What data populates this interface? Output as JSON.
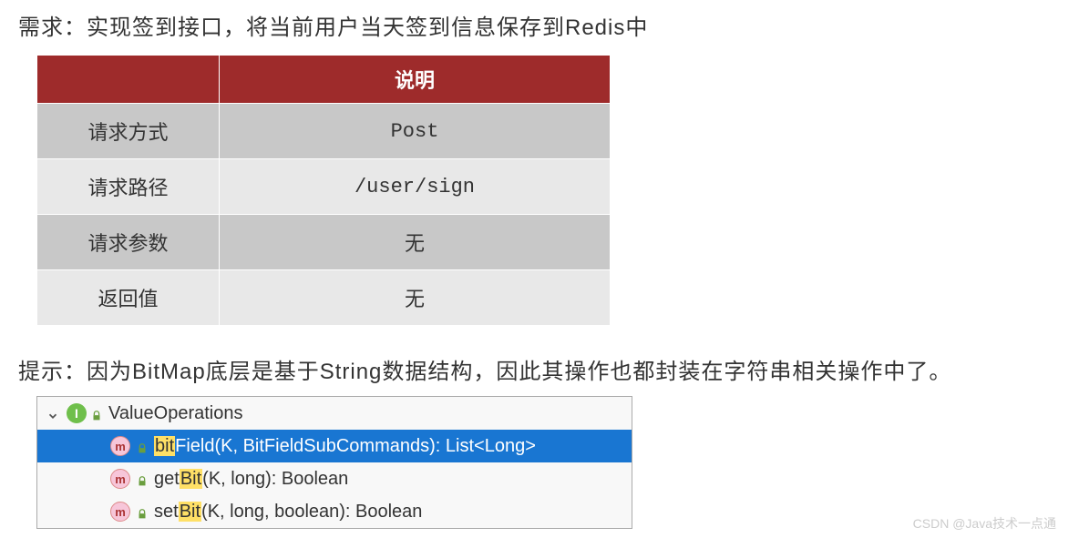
{
  "requirement": "需求：实现签到接口，将当前用户当天签到信息保存到Redis中",
  "table": {
    "header_left": "",
    "header_right": "说明",
    "rows": [
      {
        "label": "请求方式",
        "value": "Post"
      },
      {
        "label": "请求路径",
        "value": "/user/sign"
      },
      {
        "label": "请求参数",
        "value": "无"
      },
      {
        "label": "返回值",
        "value": "无"
      }
    ]
  },
  "hint": "提示：因为BitMap底层是基于String数据结构，因此其操作也都封装在字符串相关操作中了。",
  "tree": {
    "root": {
      "icon_letter": "I",
      "name": "ValueOperations"
    },
    "methods": [
      {
        "selected": true,
        "highlight": "bit",
        "rest": "Field(K, BitFieldSubCommands): List<Long>"
      },
      {
        "selected": false,
        "prefix": "get",
        "highlight": "Bit",
        "rest": "(K, long): Boolean"
      },
      {
        "selected": false,
        "prefix": "set",
        "highlight": "Bit",
        "rest": "(K, long, boolean): Boolean"
      }
    ]
  },
  "watermark": "CSDN @Java技术一点通"
}
